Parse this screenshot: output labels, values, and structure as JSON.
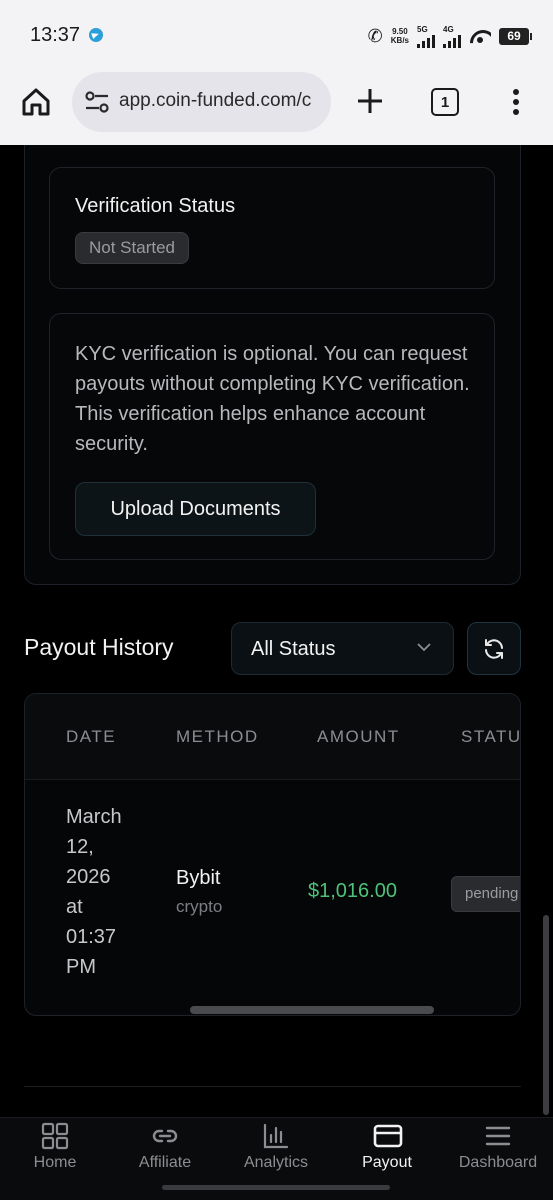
{
  "status_bar": {
    "time": "13:37",
    "speed_value": "9.50",
    "speed_unit": "KB/s",
    "net1": "5G",
    "net2": "4G",
    "battery": "69"
  },
  "browser": {
    "url": "app.coin-funded.com/c",
    "tab_count": "1"
  },
  "verification": {
    "title": "Verification Status",
    "status_badge": "Not Started"
  },
  "kyc": {
    "message": "KYC verification is optional. You can request payouts without completing KYC verification. This verification helps enhance account security.",
    "upload_label": "Upload Documents"
  },
  "payout_history": {
    "title": "Payout History",
    "filter_value": "All Status",
    "columns": [
      "DATE",
      "METHOD",
      "AMOUNT",
      "STATUS"
    ],
    "rows": [
      {
        "date_lines": [
          "March",
          "12,",
          "2026",
          "at",
          "01:37",
          "PM"
        ],
        "method": "Bybit",
        "method_type": "crypto",
        "amount": "$1,016.00",
        "status": "pending"
      }
    ]
  },
  "bottom_nav": {
    "items": [
      {
        "label": "Home",
        "icon": "grid-icon"
      },
      {
        "label": "Affiliate",
        "icon": "link-icon"
      },
      {
        "label": "Analytics",
        "icon": "bar-chart-icon"
      },
      {
        "label": "Payout",
        "icon": "credit-card-icon",
        "active": true
      },
      {
        "label": "Dashboard",
        "icon": "menu-icon"
      }
    ]
  },
  "colors": {
    "accent_green": "#4ec27a",
    "background": "#000000",
    "browser_chrome": "#f3f3f6"
  }
}
